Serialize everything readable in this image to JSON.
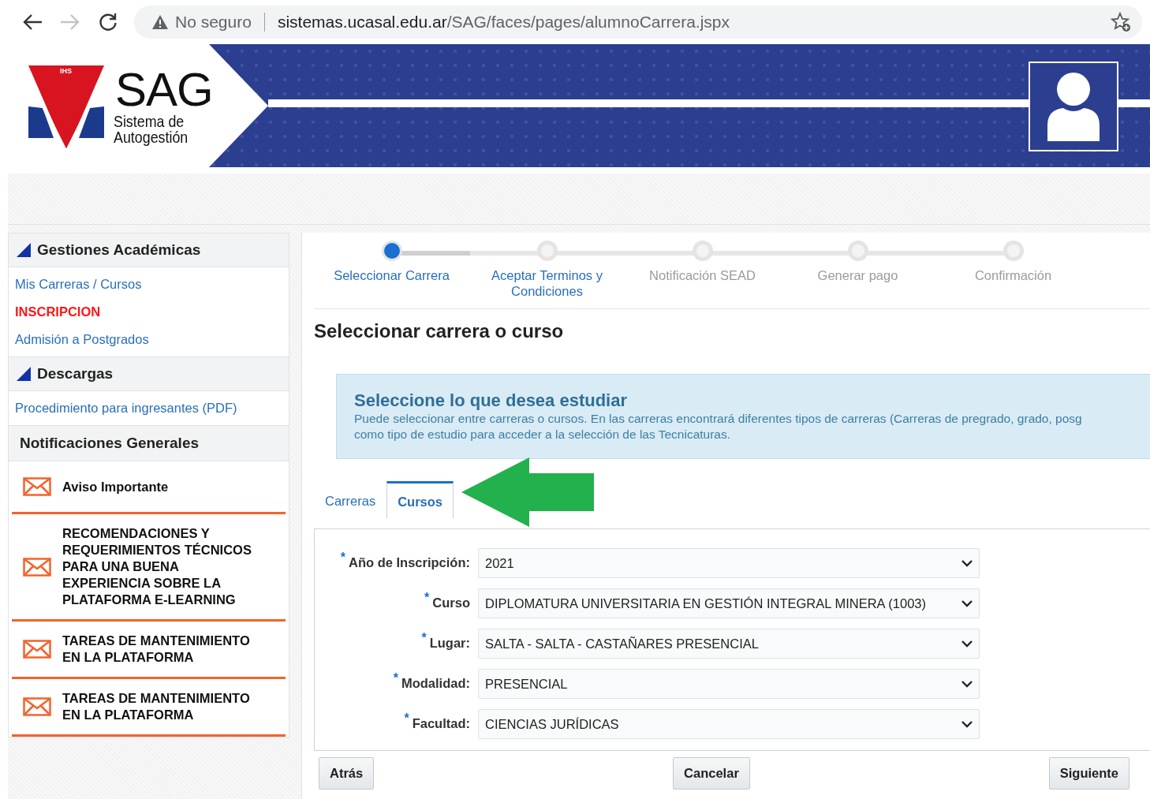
{
  "browser": {
    "security": "No seguro",
    "url_host": "sistemas.ucasal.edu.ar",
    "url_path": "/SAG/faces/pages/alumnoCarrera.jspx",
    "forward_disabled": true
  },
  "header": {
    "logo_mark": "IHS",
    "logo_title": "SAG",
    "logo_subtitle_1": "Sistema de",
    "logo_subtitle_2": "Autogestión"
  },
  "sidebar": {
    "sections": [
      {
        "title": "Gestiones Académicas",
        "links": [
          {
            "label": "Mis Carreras / Cursos",
            "highlighted": false
          },
          {
            "label": "INSCRIPCION",
            "highlighted": true
          },
          {
            "label": "Admisión a Postgrados",
            "highlighted": false
          }
        ]
      },
      {
        "title": "Descargas",
        "links": [
          {
            "label": "Procedimiento para ingresantes (PDF)",
            "highlighted": false
          }
        ]
      }
    ],
    "notifications_title": "Notificaciones Generales",
    "notifications": [
      "Aviso Importante",
      "RECOMENDACIONES Y REQUERIMIENTOS TÉCNICOS PARA UNA BUENA EXPERIENCIA SOBRE LA PLATAFORMA E-LEARNING",
      "TAREAS DE MANTENIMIENTO EN LA PLATAFORMA",
      "TAREAS DE MANTENIMIENTO EN LA PLATAFORMA"
    ]
  },
  "steps": [
    {
      "label": "Seleccionar Carrera",
      "selected": true,
      "disabled": false
    },
    {
      "label": "Aceptar Terminos y Condiciones",
      "selected": false,
      "disabled": false
    },
    {
      "label": "Notificación SEAD",
      "selected": false,
      "disabled": true
    },
    {
      "label": "Generar pago",
      "selected": false,
      "disabled": true
    },
    {
      "label": "Confirmación",
      "selected": false,
      "disabled": true
    }
  ],
  "page_title": "Seleccionar carrera o curso",
  "info": {
    "title": "Seleccione lo que desea estudiar",
    "text": "Puede seleccionar entre carreras o cursos. En las carreras encontrará diferentes tipos de carreras (Carreras de pregrado, grado, posg\ncomo tipo de estudio para acceder a la selección de las Tecnicaturas."
  },
  "tabs": [
    {
      "label": "Carreras",
      "selected": false
    },
    {
      "label": "Cursos",
      "selected": true
    }
  ],
  "fields": [
    {
      "label": "Año de Inscripción:",
      "required_mark": "*",
      "value": "2021"
    },
    {
      "label": "Curso",
      "required_mark": "*",
      "value": "DIPLOMATURA UNIVERSITARIA EN GESTIÓN INTEGRAL MINERA (1003)"
    },
    {
      "label": "Lugar:",
      "required_mark": "*",
      "value": "SALTA - SALTA - CASTAÑARES PRESENCIAL"
    },
    {
      "label": "Modalidad:",
      "required_mark": "*",
      "value": "PRESENCIAL"
    },
    {
      "label": "Facultad:",
      "required_mark": "*",
      "value": "CIENCIAS JURÍDICAS"
    }
  ],
  "buttons": [
    "Atrás",
    "Cancelar",
    "Siguiente"
  ]
}
